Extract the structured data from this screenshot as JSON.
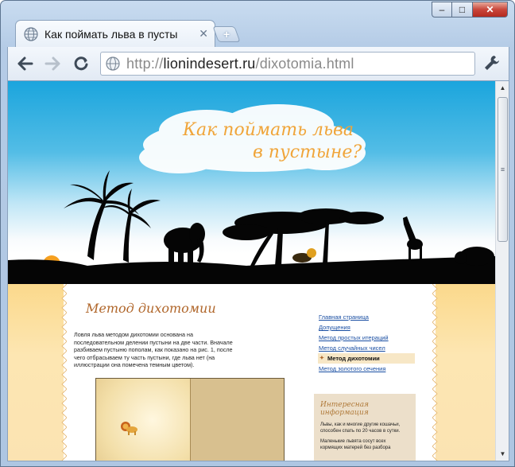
{
  "window": {
    "min_glyph": "–",
    "max_glyph": "□",
    "close_glyph": "✕"
  },
  "tab": {
    "title": "Как поймать льва в пусты",
    "close_glyph": "✕",
    "new_tab_glyph": "+"
  },
  "toolbar": {
    "back_glyph": "←",
    "forward_glyph": "→",
    "reload_glyph": "C",
    "url_prefix": "http://",
    "url_host": "lionindesert.ru",
    "url_path": "/dixotomia.html"
  },
  "site": {
    "title_line1": "Как поймать льва",
    "title_line2": "в пустыне?"
  },
  "article": {
    "title": "Метод дихотомии",
    "text": "Ловля льва методом дихотомии основана на последовательном делении пустыни на две части. Вначале разбиваем пустыню пополам, как показано на рис. 1, после чего отбрасываем ту часть пустыни, где льва нет (на иллюстрации она помечена темным цветом)."
  },
  "menu": {
    "items": [
      {
        "label": "Главная страница"
      },
      {
        "label": "Допущения"
      },
      {
        "label": "Метод простых итераций"
      },
      {
        "label": "Метод случайных чисел"
      },
      {
        "label": "Метод дихотомии"
      },
      {
        "label": "Метод золотого сечения"
      }
    ]
  },
  "infobox": {
    "title": "Интересная информация",
    "text1": "Львы, как и многие другие кошачьи, способен спать по 20 часов в сутки.",
    "text2": "Маленькие львята сосут всех кормящих матерей без разбора"
  },
  "scrollbar": {
    "up_glyph": "▲",
    "down_glyph": "▼",
    "grip_glyph": "≡"
  },
  "colors": {
    "accent_link": "#1a4fa3",
    "title_orange": "#f0a53a",
    "heading_brown": "#b0662a"
  }
}
